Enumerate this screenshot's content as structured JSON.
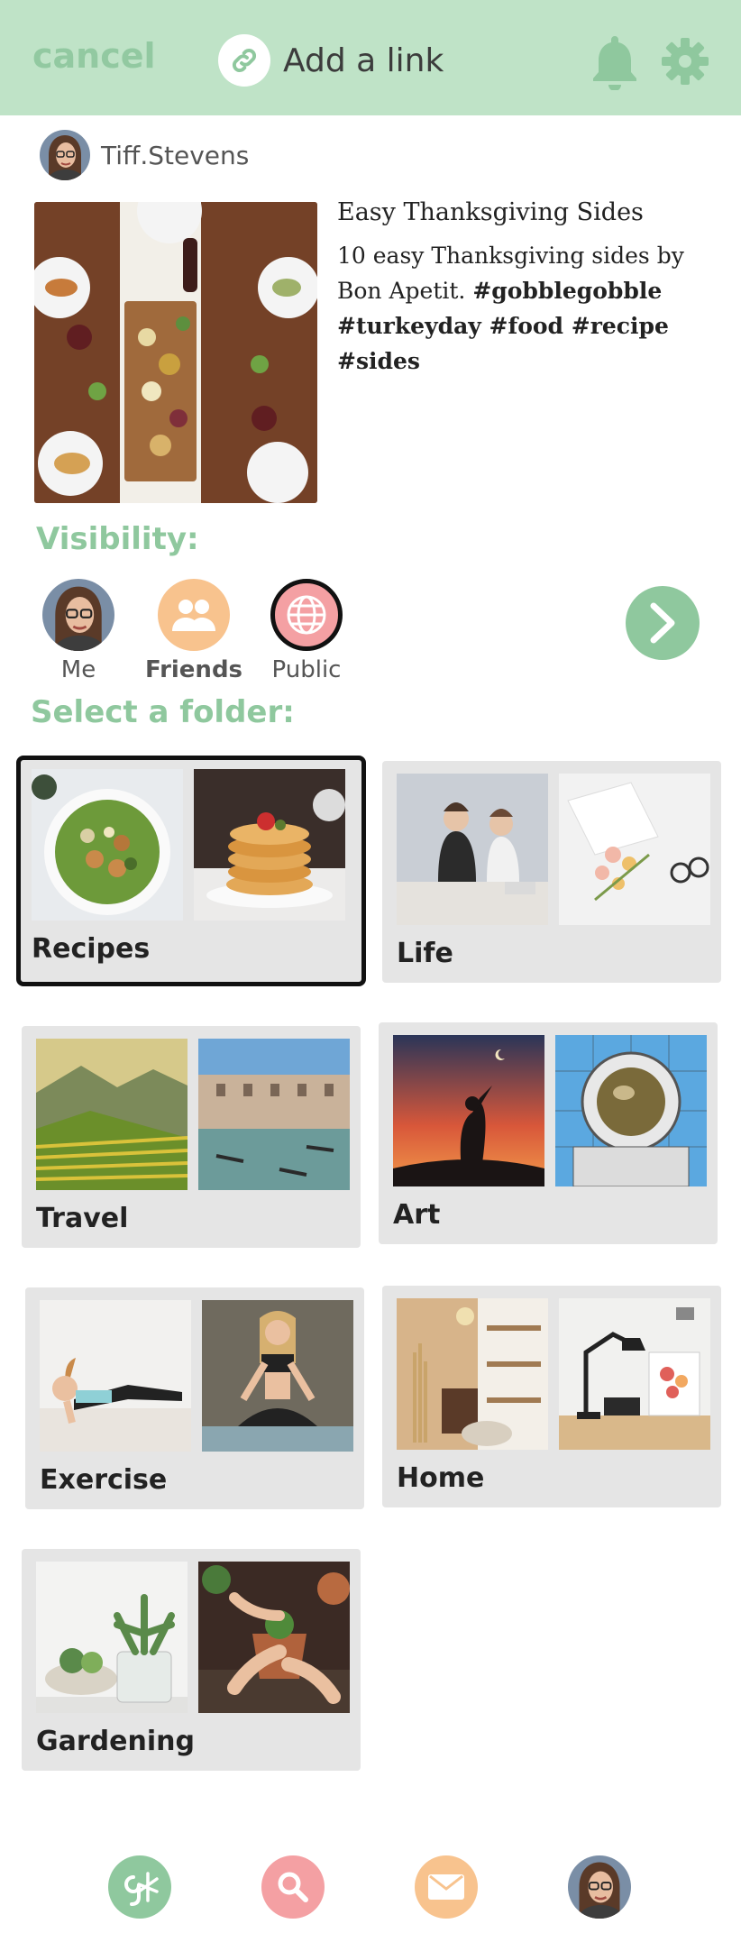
{
  "header": {
    "cancel_label": "cancel",
    "add_link_label": "Add a link",
    "background_color": "#bfe3c7",
    "accent_color": "#8fc89e",
    "icons": [
      "link-icon",
      "bell-icon",
      "gear-icon"
    ]
  },
  "user": {
    "name": "Tiff.Stevens"
  },
  "post": {
    "title": "Easy Thanksgiving Sides",
    "description": "10 easy Thanksgiving sides by Bon Apetit.",
    "tags": "#gobblegobble #turkeyday #food #recipe #sides"
  },
  "visibility": {
    "label": "Visibility:",
    "options": [
      {
        "label": "Me"
      },
      {
        "label": "Friends"
      },
      {
        "label": "Public"
      }
    ],
    "selected": "Public"
  },
  "folders": {
    "label": "Select a folder:",
    "items": [
      {
        "name": "Recipes"
      },
      {
        "name": "Life"
      },
      {
        "name": "Travel"
      },
      {
        "name": "Art"
      },
      {
        "name": "Exercise"
      },
      {
        "name": "Home"
      },
      {
        "name": "Gardening"
      }
    ],
    "selected": "Recipes"
  },
  "bottom_nav": {
    "items": [
      "home-logo-icon",
      "search-icon",
      "mail-icon",
      "profile-avatar"
    ],
    "colors": {
      "home": "#8fc89e",
      "search": "#f4a0a3",
      "mail": "#f8c38e"
    }
  }
}
